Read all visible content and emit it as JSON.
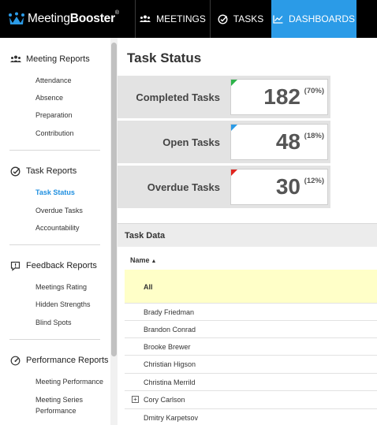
{
  "brand": {
    "prefix": "Meeting",
    "suffix": "Booster",
    "mark": "®"
  },
  "nav": {
    "meetings": "MEETINGS",
    "tasks": "TASKS",
    "dashboards": "DASHBOARDS",
    "active": "dashboards",
    "accent_color": "#2b9be7"
  },
  "sidebar": {
    "sections": [
      {
        "title": "Meeting Reports",
        "icon": "people-icon",
        "items": [
          "Attendance",
          "Absence",
          "Preparation",
          "Contribution"
        ]
      },
      {
        "title": "Task Reports",
        "icon": "check-circle-icon",
        "items": [
          "Task Status",
          "Overdue Tasks",
          "Accountability"
        ]
      },
      {
        "title": "Feedback Reports",
        "icon": "feedback-icon",
        "items": [
          "Meetings Rating",
          "Hidden Strengths",
          "Blind Spots"
        ]
      },
      {
        "title": "Performance Reports",
        "icon": "gauge-icon",
        "items": [
          "Meeting Performance",
          "Meeting Series",
          "Performance"
        ]
      }
    ],
    "active_item": "Task Status",
    "active_color": "#1f8fe0"
  },
  "page": {
    "title": "Task Status"
  },
  "stats": [
    {
      "label": "Completed Tasks",
      "value": "182",
      "percent": "(70%)",
      "flag_color": "#2db34a"
    },
    {
      "label": "Open Tasks",
      "value": "48",
      "percent": "(18%)",
      "flag_color": "#2b9be7"
    },
    {
      "label": "Overdue Tasks",
      "value": "30",
      "percent": "(12%)",
      "flag_color": "#e0251f"
    }
  ],
  "task_data": {
    "title": "Task Data",
    "column_header": "Name",
    "sort_indicator": "▲",
    "rows": [
      {
        "name": "All",
        "highlight": true
      },
      {
        "name": "Brady Friedman"
      },
      {
        "name": "Brandon Conrad"
      },
      {
        "name": "Brooke Brewer"
      },
      {
        "name": "Christian Higson"
      },
      {
        "name": "Christina Merrild"
      },
      {
        "name": "Cory Carlson",
        "expandable": true,
        "expander": "+"
      },
      {
        "name": "Dmitry Karpetsov"
      }
    ]
  }
}
